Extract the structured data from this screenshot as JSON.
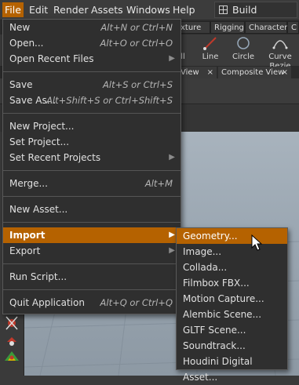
{
  "menubar": {
    "items": [
      "File",
      "Edit",
      "Render",
      "Assets",
      "Windows",
      "Help"
    ],
    "desktop": "Build"
  },
  "shelf": {
    "tabs": [
      "xture",
      "Rigging",
      "Characters",
      "C"
    ],
    "tools": [
      "ll",
      "Line",
      "Circle",
      "Curve Bezie"
    ]
  },
  "panes": {
    "tabs": [
      "View",
      "Composite View"
    ],
    "close": "×"
  },
  "file_menu": {
    "items": [
      {
        "label": "New",
        "shortcut": "Alt+N or Ctrl+N"
      },
      {
        "label": "Open...",
        "shortcut": "Alt+O or Ctrl+O"
      },
      {
        "label": "Open Recent Files",
        "submenu": "▶"
      },
      {
        "label": "Save",
        "shortcut": "Alt+S or Ctrl+S"
      },
      {
        "label": "Save As...",
        "shortcut": "Alt+Shift+S or Ctrl+Shift+S"
      },
      {
        "label": "New Project..."
      },
      {
        "label": "Set Project..."
      },
      {
        "label": "Set Recent Projects",
        "submenu": "▶"
      },
      {
        "label": "Merge...",
        "shortcut": "Alt+M"
      },
      {
        "label": "New Asset..."
      },
      {
        "label": "Import",
        "submenu": "▶"
      },
      {
        "label": "Export",
        "submenu": "▶"
      },
      {
        "label": "Run Script..."
      },
      {
        "label": "Quit Application",
        "shortcut": "Alt+Q or Ctrl+Q"
      }
    ]
  },
  "import_menu": {
    "items": [
      "Geometry...",
      "Image...",
      "Collada...",
      "Filmbox FBX...",
      "Motion Capture...",
      "Alembic Scene...",
      "GLTF Scene...",
      "Soundtrack...",
      "Houdini Digital Asset..."
    ]
  },
  "colors": {
    "highlight": "#b56200",
    "menu_bg": "#2f2f2f",
    "viewport": "#9aa6b1"
  }
}
